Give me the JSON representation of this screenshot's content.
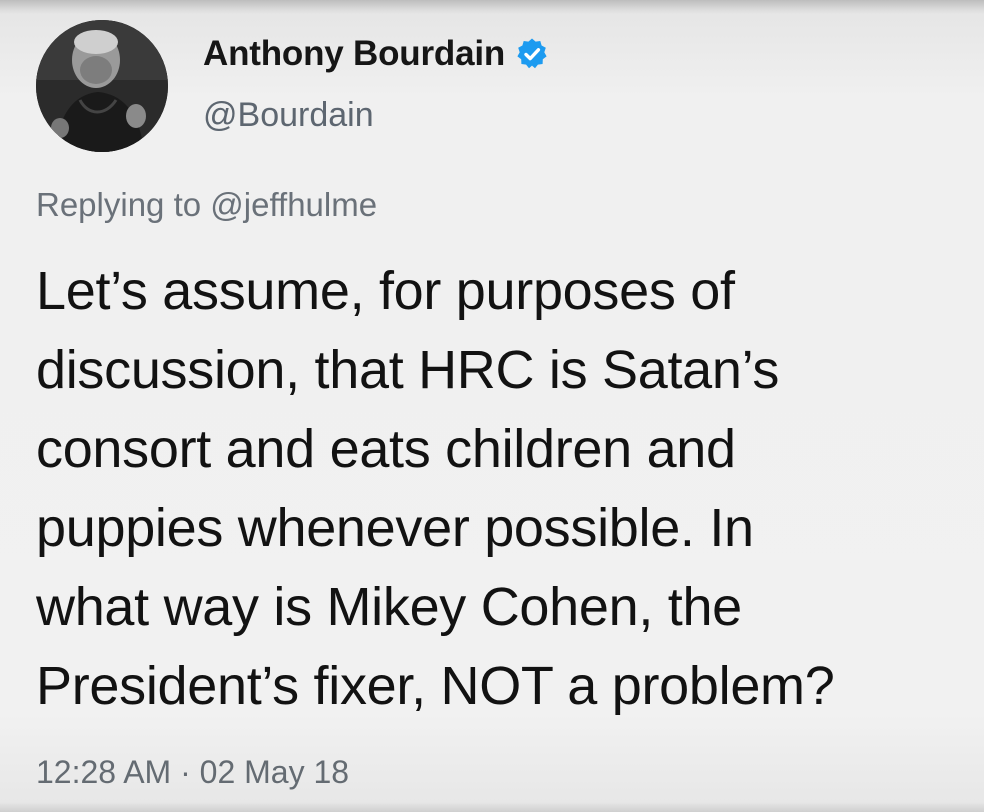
{
  "tweet": {
    "author": {
      "name": "Anthony Bourdain",
      "handle": "@Bourdain",
      "verified": true
    },
    "replying_prefix": "Replying to",
    "replying_to": "@jeffhulme",
    "text_lines": [
      "Let’s assume, for purposes of",
      "discussion, that HRC is Satan’s",
      "consort and eats children and",
      "puppies whenever possible. In",
      "what way is Mikey Cohen, the",
      "President’s fixer, NOT a problem?"
    ],
    "timestamp": "12:28 AM · 02 May 18"
  },
  "icons": {
    "avatar": "profile-photo",
    "verified": "verified-badge-icon"
  },
  "colors": {
    "verified_blue": "#1d9bf0",
    "text": "#121212",
    "muted": "#646b72"
  }
}
